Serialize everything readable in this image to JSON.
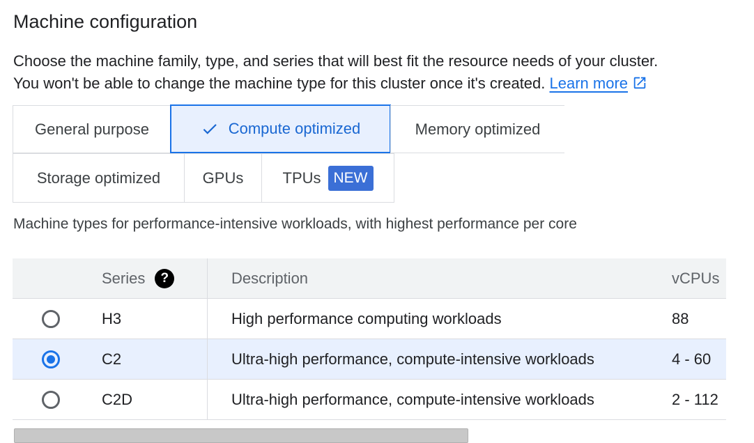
{
  "page": {
    "title": "Machine configuration",
    "description_line1": "Choose the machine family, type, and series that will best fit the resource needs of your cluster.",
    "description_line2": "You won't be able to change the machine type for this cluster once it's created.",
    "learn_more": "Learn more",
    "learn_more_icon": "open-in-new-icon"
  },
  "families": {
    "selected": "Compute optimized",
    "tabs": [
      {
        "label": "General purpose"
      },
      {
        "label": "Compute optimized",
        "icon": "check-icon"
      },
      {
        "label": "Memory optimized"
      },
      {
        "label": "Storage optimized"
      },
      {
        "label": "GPUs"
      },
      {
        "label": "TPUs",
        "badge": "NEW"
      }
    ],
    "subtitle": "Machine types for performance-intensive workloads, with highest performance per core"
  },
  "series_table": {
    "headers": {
      "series": "Series",
      "description": "Description",
      "vcpus": "vCPUs"
    },
    "help_icon": "help-icon",
    "rows": [
      {
        "series": "H3",
        "description": "High performance computing workloads",
        "vcpus": "88",
        "selected": false
      },
      {
        "series": "C2",
        "description": "Ultra-high performance, compute-intensive workloads",
        "vcpus": "4 - 60",
        "selected": true
      },
      {
        "series": "C2D",
        "description": "Ultra-high performance, compute-intensive workloads",
        "vcpus": "2 - 112",
        "selected": false
      }
    ]
  },
  "colors": {
    "accent": "#1a73e8",
    "selected_bg": "#e8f0fe",
    "badge_bg": "#3b6fd6",
    "header_bg": "#f1f3f4"
  }
}
